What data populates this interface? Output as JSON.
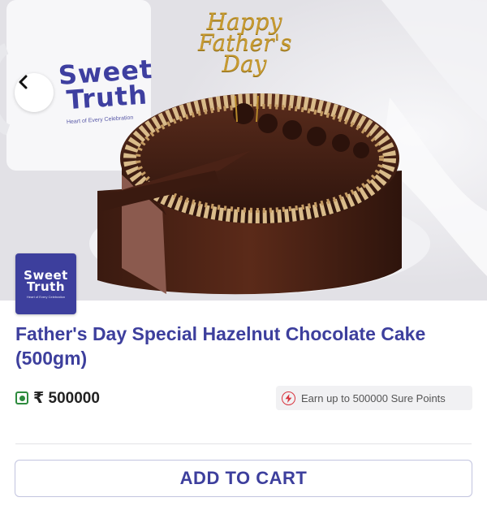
{
  "hero": {
    "mug_brand_line1": "Sweet",
    "mug_brand_line2": "Truth",
    "mug_brand_tagline": "Heart of Every Celebration",
    "topper_line1": "Happy",
    "topper_line2": "Father's",
    "topper_line3": "Day"
  },
  "logo": {
    "line1": "Sweet",
    "line2": "Truth",
    "tagline": "Heart of Every Celebration"
  },
  "product": {
    "title": "Father's Day Special Hazelnut Chocolate Cake (500gm)",
    "price": "₹ 500000",
    "points_text": "Earn up to 500000 Sure Points",
    "add_to_cart_label": "ADD TO CART"
  },
  "icons": {
    "back": "chevron-left-icon",
    "veg": "veg-indicator-icon",
    "points": "lightning-icon"
  },
  "colors": {
    "brand": "#3d3f9d",
    "veg": "#2e8b3e",
    "points_accent": "#d8343e"
  }
}
